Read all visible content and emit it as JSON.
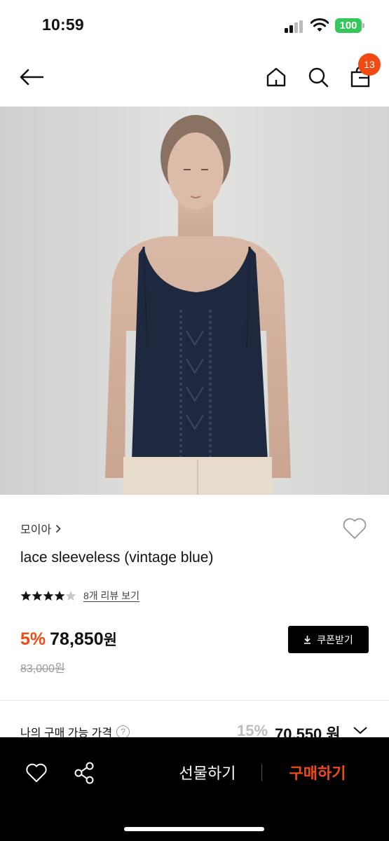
{
  "status_bar": {
    "time": "10:59",
    "battery": "100",
    "battery_color": "#34c759"
  },
  "nav": {
    "cart_count": "13",
    "accent": "#f04b12"
  },
  "product": {
    "brand": "모이아",
    "name": "lace sleeveless (vintage blue)",
    "rating": 4.5,
    "review_link": "8개 리뷰 보기",
    "discount": "5%",
    "price": "78,850",
    "won": "원",
    "original_price": "83,000원",
    "coupon_button": "쿠폰받기"
  },
  "my_price": {
    "label": "나의 구매 가능 가격",
    "help": "?",
    "discount": "15%",
    "price": "70,550 원"
  },
  "bottom_bar": {
    "gift_label": "선물하기",
    "buy_label": "구매하기"
  },
  "icons": {
    "back": "arrow-left-icon",
    "home": "home-icon",
    "search": "search-icon",
    "bag": "shopping-bag-icon",
    "wish": "heart-outline-icon",
    "share": "share-icon",
    "coupon": "download-icon"
  }
}
